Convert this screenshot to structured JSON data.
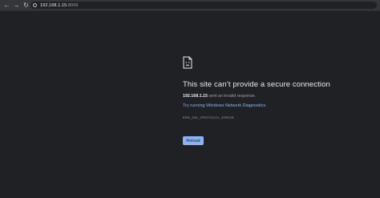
{
  "toolbar": {
    "back_icon": "back-arrow-icon",
    "forward_icon": "forward-arrow-icon",
    "reload_icon": "reload-icon",
    "address": {
      "host": "192.168.1.15",
      "port_suffix": ":8006"
    }
  },
  "error_page": {
    "icon": "sad-document-icon",
    "title": "This site can’t provide a secure connection",
    "host": "192.168.1.15",
    "message": " sent an invalid response.",
    "diagnostics_link": "Try running Windows Network Diagnostics.",
    "error_code": "ERR_SSL_PROTOCOL_ERROR",
    "reload_button": "Reload"
  },
  "colors": {
    "background": "#202124",
    "toolbar": "#35363a",
    "link": "#8ab4f8",
    "button": "#8ab4f8"
  }
}
